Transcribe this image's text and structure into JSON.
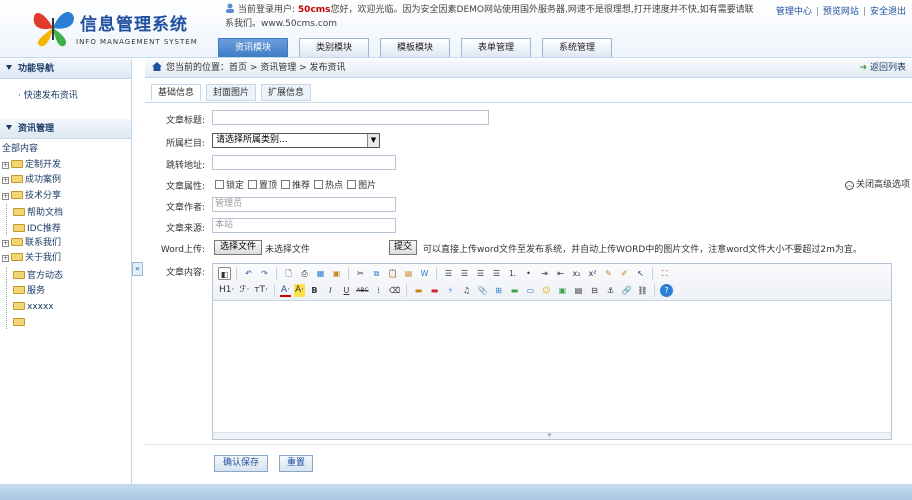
{
  "header": {
    "title": "信息管理系统",
    "subtitle": "INFO MANAGEMENT SYSTEM",
    "notice_prefix": "当前登录用户:",
    "notice_user": "50cms",
    "notice_text": "您好，欢迎光临。因为安全因素DEMO网站使用国外服务器,网速不是很理想,打开速度并不快,如有需要请联系我们。www.50cms.com",
    "links": [
      "管理中心",
      "预览网站",
      "安全退出"
    ],
    "nav": [
      "资讯模块",
      "类别模块",
      "模板模块",
      "表单管理",
      "系统管理"
    ]
  },
  "sidebar": {
    "section1_title": "功能导航",
    "quick_link": "快速发布资讯",
    "section2_title": "资讯管理",
    "tree": [
      {
        "label": "全部内容",
        "expandable": false
      },
      {
        "label": "定制开发",
        "expandable": true
      },
      {
        "label": "成功案例",
        "expandable": true
      },
      {
        "label": "技术分享",
        "expandable": true
      },
      {
        "label": "帮助文档",
        "expandable": false
      },
      {
        "label": "IDC推荐",
        "expandable": false
      },
      {
        "label": "联系我们",
        "expandable": true
      },
      {
        "label": "关于我们",
        "expandable": true
      },
      {
        "label": "官方动态",
        "expandable": false
      },
      {
        "label": "服务",
        "expandable": false
      },
      {
        "label": "xxxxx",
        "expandable": false
      },
      {
        "label": "",
        "expandable": false
      }
    ],
    "collapse_glyph": "«"
  },
  "main": {
    "breadcrumb": "您当前的位置：首页 > 资讯管理 > 发布资讯",
    "back_label": "返回列表",
    "tabs": [
      "基础信息",
      "封面图片",
      "扩展信息"
    ],
    "form": {
      "title_label": "文章标题:",
      "title_value": "",
      "category_label": "所属栏目:",
      "category_value": "请选择所属类别...",
      "redirect_label": "跳转地址:",
      "redirect_value": "",
      "attr_label": "文章属性:",
      "attrs": [
        "锁定",
        "置顶",
        "推荐",
        "热点",
        "图片"
      ],
      "adv_toggle": "关闭高级选项",
      "author_label": "文章作者:",
      "author_value": "管理员",
      "source_label": "文章来源:",
      "source_value": "本站",
      "word_label": "Word上传:",
      "choose_file": "选择文件",
      "no_file": "未选择文件",
      "submit_file": "提交",
      "word_hint": "可以直接上传word文件至发布系统，并自动上传WORD中的图片文件，注意word文件大小不要超过2m为宜。",
      "content_label": "文章内容:",
      "toolbar_row2_text": [
        "H1·",
        "ℱ·",
        "тT·",
        "A·",
        "A·"
      ]
    },
    "save_button": "确认保存",
    "reset_button": "重置"
  },
  "colors": {
    "brand": "#1f4f9e",
    "active_tab": "#3f7bc6",
    "user_highlight": "#cc0000",
    "footer": "#a9c6e4"
  }
}
